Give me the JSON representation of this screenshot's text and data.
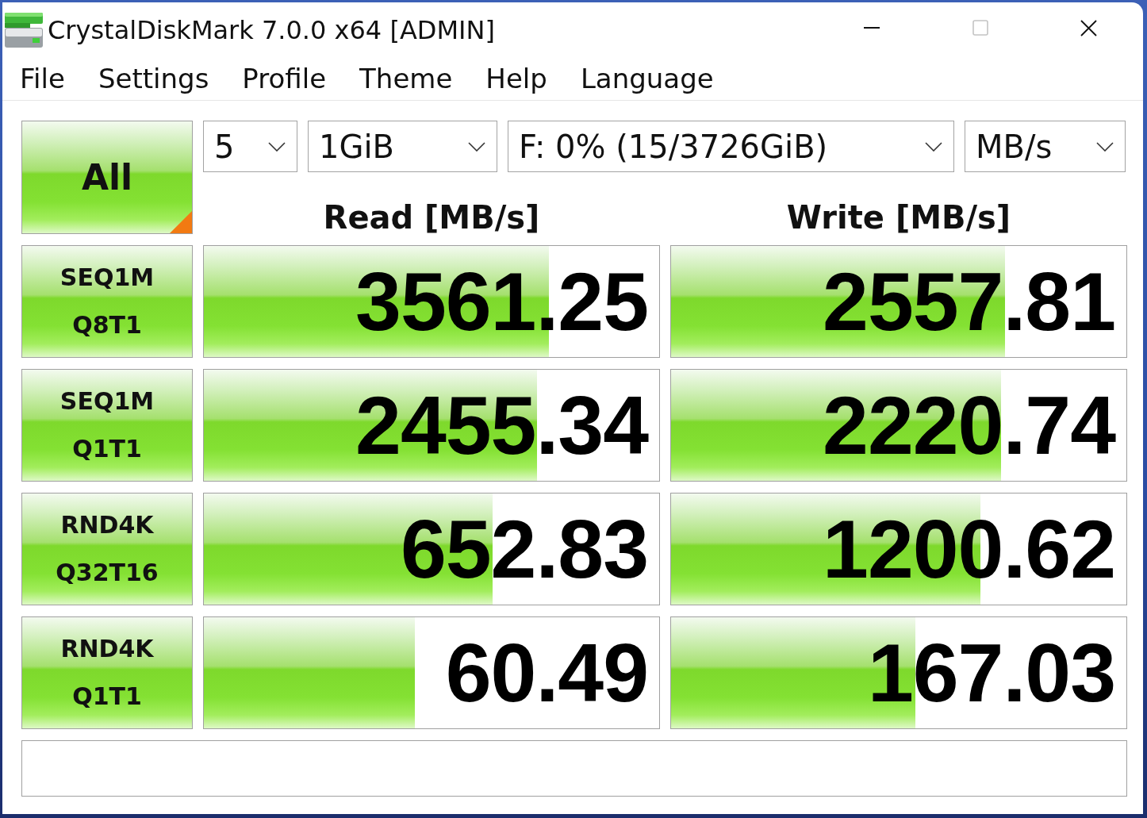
{
  "window": {
    "title": "CrystalDiskMark 7.0.0 x64 [ADMIN]",
    "maximize_disabled": true
  },
  "menu": [
    "File",
    "Settings",
    "Profile",
    "Theme",
    "Help",
    "Language"
  ],
  "toolbar": {
    "all_button": "All",
    "dropdowns": [
      "5",
      "1GiB",
      "F: 0% (15/3726GiB)",
      "MB/s"
    ]
  },
  "columns": [
    "Read [MB/s]",
    "Write [MB/s]"
  ],
  "tests": [
    {
      "label": [
        "SEQ1M",
        "Q8T1"
      ],
      "read": {
        "value": "3561.25",
        "level": 0.757
      },
      "write": {
        "value": "2557.81",
        "level": 0.734
      }
    },
    {
      "label": [
        "SEQ1M",
        "Q1T1"
      ],
      "read": {
        "value": "2455.34",
        "level": 0.732
      },
      "write": {
        "value": "2220.74",
        "level": 0.725
      }
    },
    {
      "label": [
        "RND4K",
        "Q32T16"
      ],
      "read": {
        "value": "652.83",
        "level": 0.635
      },
      "write": {
        "value": "1200.62",
        "level": 0.68
      }
    },
    {
      "label": [
        "RND4K",
        "Q1T1"
      ],
      "read": {
        "value": "60.49",
        "level": 0.463
      },
      "write": {
        "value": "167.03",
        "level": 0.537
      }
    }
  ]
}
